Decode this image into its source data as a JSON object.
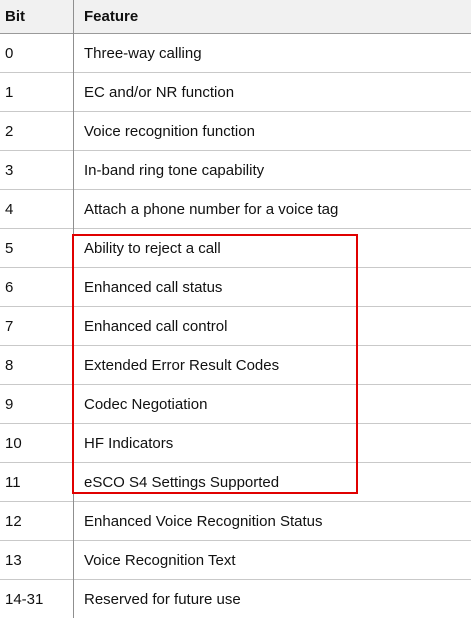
{
  "table": {
    "headers": {
      "bit": "Bit",
      "feature": "Feature"
    },
    "rows": [
      {
        "bit": "0",
        "feature": "Three-way calling"
      },
      {
        "bit": "1",
        "feature": "EC and/or NR function"
      },
      {
        "bit": "2",
        "feature": "Voice recognition function"
      },
      {
        "bit": "3",
        "feature": "In-band ring tone capability"
      },
      {
        "bit": "4",
        "feature": "Attach a phone number for a voice tag"
      },
      {
        "bit": "5",
        "feature": "Ability to reject a call"
      },
      {
        "bit": "6",
        "feature": "Enhanced call status"
      },
      {
        "bit": "7",
        "feature": "Enhanced call control"
      },
      {
        "bit": "8",
        "feature": "Extended Error Result Codes"
      },
      {
        "bit": "9",
        "feature": "Codec Negotiation"
      },
      {
        "bit": "10",
        "feature": "HF Indicators"
      },
      {
        "bit": "11",
        "feature": "eSCO S4 Settings Supported"
      },
      {
        "bit": "12",
        "feature": "Enhanced Voice Recognition Status"
      },
      {
        "bit": "13",
        "feature": "Voice Recognition Text"
      },
      {
        "bit": "14-31",
        "feature": "Reserved for future use"
      }
    ]
  },
  "highlight": {
    "color": "#e00000",
    "rows_from_bit": "5",
    "rows_to_bit": "11"
  },
  "colors": {
    "header_background": "#f1f1f1",
    "divider": "#8f8f8f",
    "row_border": "#c9c9c9"
  }
}
